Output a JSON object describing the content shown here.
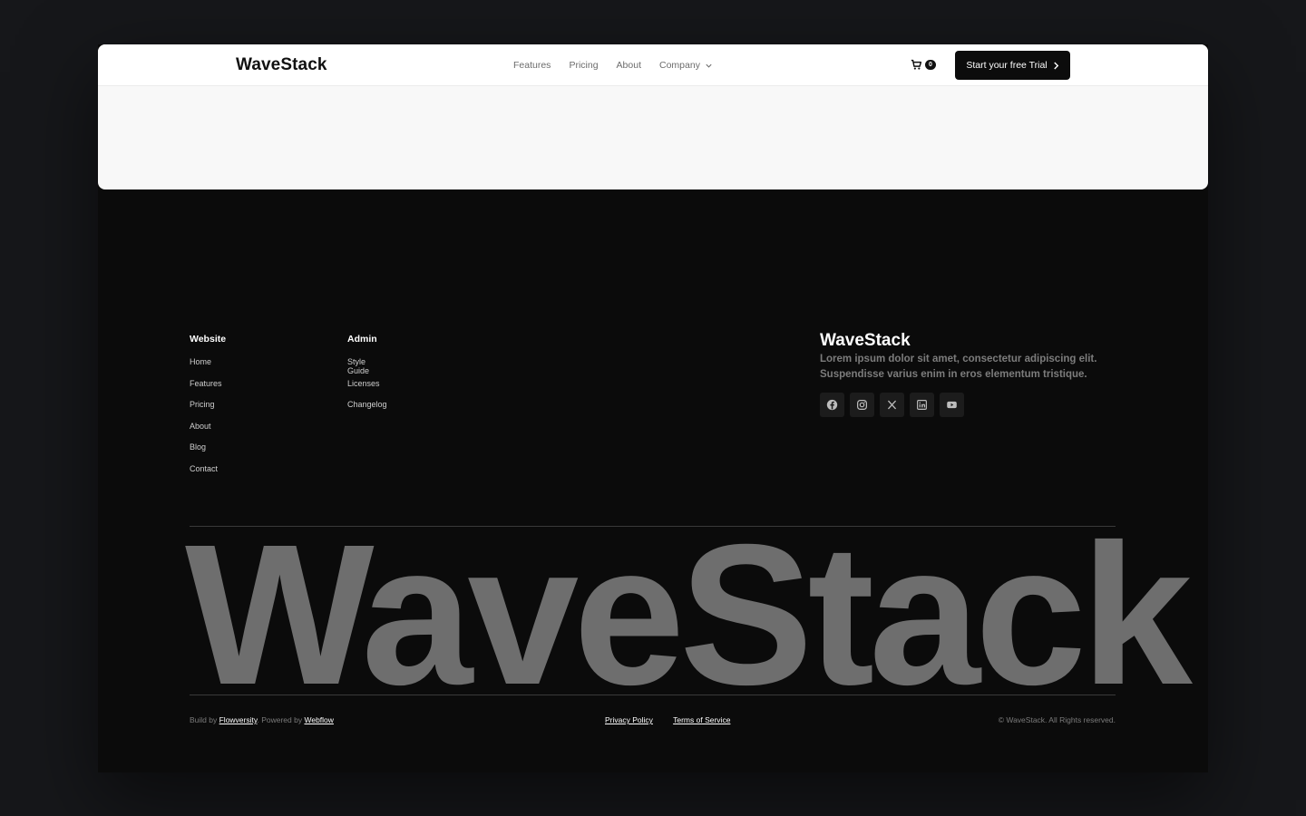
{
  "navbar": {
    "logo": "WaveStack",
    "links": [
      "Features",
      "Pricing",
      "About",
      "Company"
    ],
    "cart_count": "0",
    "cta_label": "Start your free Trial"
  },
  "footer": {
    "columns": [
      {
        "title": "Website",
        "links": [
          "Home",
          "Features",
          "Pricing",
          "About",
          "Blog",
          "Contact"
        ]
      },
      {
        "title": "Admin",
        "links": [
          "Style Guide",
          "Licenses",
          "Changelog"
        ]
      }
    ],
    "brand": {
      "name": "WaveStack",
      "description": "Lorem ipsum dolor sit amet, consectetur adipiscing elit. Suspendisse varius enim in eros elementum tristique."
    },
    "socials": [
      "facebook-icon",
      "instagram-icon",
      "x-icon",
      "linkedin-icon",
      "youtube-icon"
    ],
    "big_wordmark": "WaveStack",
    "credits": {
      "build_prefix": "Build by ",
      "build_link": "Flowversity",
      "powered_prefix": ". Powered by ",
      "powered_link": "Webflow"
    },
    "legal_links": [
      "Privacy Policy",
      "Terms of Service"
    ],
    "copyright": "© WaveStack. All Rights reserved."
  },
  "colors": {
    "page_bg": "#16171a",
    "footer_bg": "#0b0b0b",
    "wordmark": "#6e6e6e",
    "cta_bg": "#0c0c0c"
  }
}
